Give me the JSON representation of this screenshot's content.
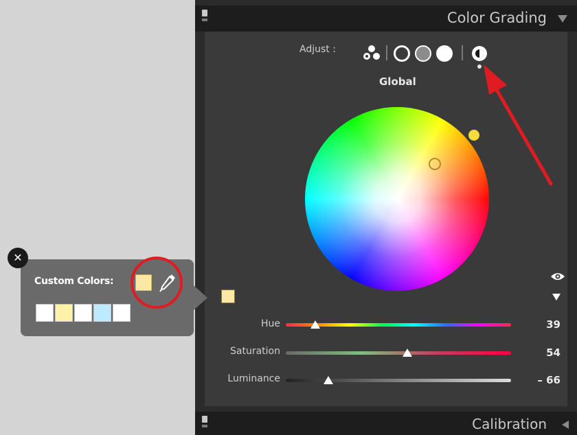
{
  "panel": {
    "title": "Color Grading",
    "footer_title": "Calibration"
  },
  "adjust": {
    "label": "Adjust :",
    "modes": [
      "3-way",
      "shadows",
      "midtones",
      "highlights",
      "global"
    ],
    "selected_mode": "global",
    "mode_title": "Global"
  },
  "wheel": {
    "handle_color": "#b48a2a",
    "outer_dot_color": "#f4dc3a"
  },
  "sliders": [
    {
      "label": "Hue",
      "value": "39",
      "position": 0.13
    },
    {
      "label": "Saturation",
      "value": "54",
      "position": 0.54
    },
    {
      "label": "Luminance",
      "value": "– 66",
      "position": 0.19
    }
  ],
  "selected_swatch_color": "#fbe8a5",
  "popover": {
    "label": "Custom Colors:",
    "current_swatch": "#fbe8a5",
    "swatches": [
      "#ffffff",
      "#fdf2a8",
      "#ffffff",
      "#bdeaff",
      "#ffffff"
    ]
  },
  "annotations": {
    "highlight_color": "#e11b22"
  }
}
